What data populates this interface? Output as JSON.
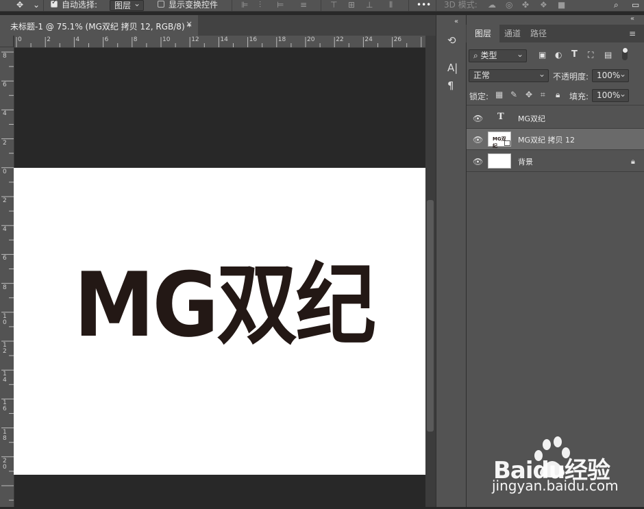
{
  "options_bar": {
    "auto_select_label": "自动选择:",
    "auto_select_target": "图层",
    "show_transform_label": "显示变换控件",
    "more_label": "•••",
    "mode_3d_label": "3D 模式:"
  },
  "document": {
    "tab_title": "未标题-1 @ 75.1% (MG双纪 拷贝 12, RGB/8) *",
    "close_glyph": "×",
    "canvas_text": "MG双纪",
    "text_color": "#231815",
    "canvas_bg": "#ffffff"
  },
  "rulers": {
    "horizontal": [
      "0",
      "2",
      "4",
      "6",
      "8",
      "10",
      "12",
      "14",
      "16",
      "18",
      "20",
      "22",
      "24",
      "26"
    ],
    "vertical": [
      "8",
      "6",
      "4",
      "2",
      "0",
      "2",
      "4",
      "6",
      "8",
      "10",
      "12",
      "14",
      "16",
      "18",
      "20"
    ]
  },
  "panel": {
    "tabs": [
      "图层",
      "通道",
      "路径"
    ],
    "active_tab": "图层",
    "filter_kind": "类型",
    "blend_mode": "正常",
    "opacity_label": "不透明度:",
    "opacity_value": "100%",
    "lock_label": "锁定:",
    "fill_label": "填充:",
    "fill_value": "100%"
  },
  "layers": [
    {
      "name": "MG双纪",
      "type": "text",
      "visible": true,
      "selected": false
    },
    {
      "name": "MG双纪 拷贝 12",
      "type": "smart-object",
      "visible": true,
      "selected": true
    },
    {
      "name": "背景",
      "type": "background",
      "visible": true,
      "selected": false,
      "locked": true
    }
  ],
  "watermark": {
    "brand": "Baidu经验",
    "url": "jingyan.baidu.com"
  },
  "icons": [
    "move-tool-icon",
    "align-icon",
    "distribute-icon",
    "3d-orbit-icon",
    "search-icon",
    "history-icon",
    "character-icon",
    "paragraph-icon",
    "eye-icon",
    "lock-icon",
    "text-layer-icon"
  ]
}
